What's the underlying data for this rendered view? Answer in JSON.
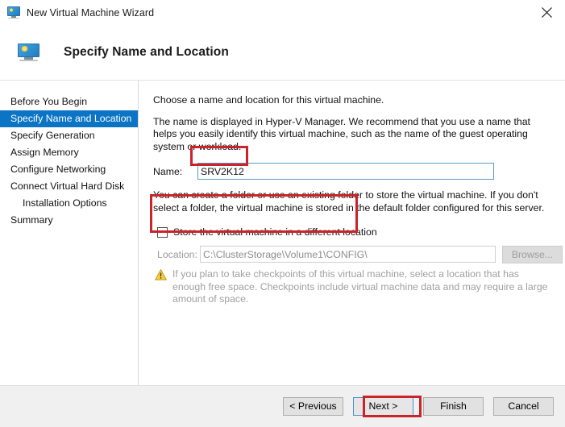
{
  "window": {
    "title": "New Virtual Machine Wizard",
    "title_icon": "virtual-machine-monitor-icon",
    "close_icon": "close-icon"
  },
  "header": {
    "title": "Specify Name and Location",
    "icon": "virtual-machine-monitor-icon"
  },
  "sidebar": {
    "items": [
      {
        "label": "Before You Begin",
        "selected": false,
        "indent": false
      },
      {
        "label": "Specify Name and Location",
        "selected": true,
        "indent": false
      },
      {
        "label": "Specify Generation",
        "selected": false,
        "indent": false
      },
      {
        "label": "Assign Memory",
        "selected": false,
        "indent": false
      },
      {
        "label": "Configure Networking",
        "selected": false,
        "indent": false
      },
      {
        "label": "Connect Virtual Hard Disk",
        "selected": false,
        "indent": false
      },
      {
        "label": "Installation Options",
        "selected": false,
        "indent": true
      },
      {
        "label": "Summary",
        "selected": false,
        "indent": false
      }
    ]
  },
  "content": {
    "intro": "Choose a name and location for this virtual machine.",
    "description": "The name is displayed in Hyper-V Manager. We recommend that you use a name that helps you easily identify this virtual machine, such as the name of the guest operating system or workload.",
    "name_label": "Name:",
    "name_value": "SRV2K12",
    "name_placeholder": "",
    "folder_description": "You can create a folder or use an existing folder to store the virtual machine. If you don't select a folder, the virtual machine is stored in the default folder configured for this server.",
    "store_checkbox_label": "Store the virtual machine in a different location",
    "store_checkbox_checked": false,
    "location_label": "Location:",
    "location_value": "C:\\ClusterStorage\\Volume1\\CONFIG\\",
    "browse_label": "Browse...",
    "browse_disabled": true,
    "warning_icon": "warning-triangle-icon",
    "warning_text": "If you plan to take checkpoints of this virtual machine, select a location that has enough free space. Checkpoints include virtual machine data and may require a large amount of space."
  },
  "footer": {
    "previous_label": "< Previous",
    "next_label": "Next >",
    "finish_label": "Finish",
    "cancel_label": "Cancel"
  },
  "annotations": {
    "color": "#cc2229",
    "boxes": [
      "name-field",
      "location-section",
      "next-button"
    ]
  },
  "colors": {
    "accent_selection": "#0b74c4",
    "annotation_red": "#cc2229",
    "warning_yellow": "#f2c229",
    "button_face": "#e1e1e1",
    "footer_bg": "#f0f0f0"
  }
}
